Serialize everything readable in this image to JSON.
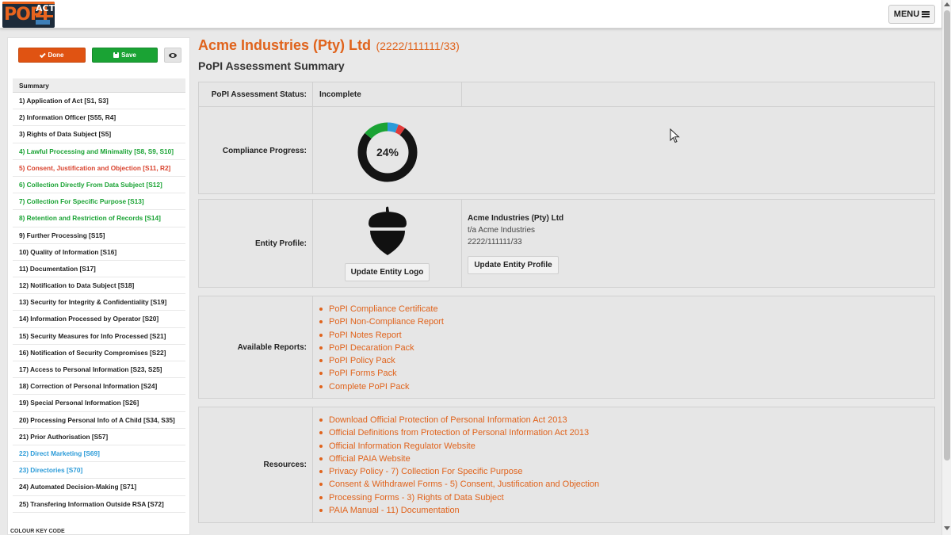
{
  "topbar": {
    "logo_text": "POPI",
    "logo_act": "ACT",
    "menu_label": "MENU"
  },
  "sidebar": {
    "done_label": "Done",
    "save_label": "Save",
    "colour_key_label": "COLOUR KEY CODE",
    "items": [
      {
        "label": "Summary",
        "status": "header"
      },
      {
        "label": "1) Application of Act [S1, S3]",
        "status": "black"
      },
      {
        "label": "2) Information Officer [S55, R4]",
        "status": "black"
      },
      {
        "label": "3) Rights of Data Subject [S5]",
        "status": "black"
      },
      {
        "label": "4) Lawful Processing and Minimality [S8, S9, S10]",
        "status": "green"
      },
      {
        "label": "5) Consent, Justification and Objection [S11, R2]",
        "status": "red"
      },
      {
        "label": "6) Collection Directly From Data Subject [S12]",
        "status": "green"
      },
      {
        "label": "7) Collection For Specific Purpose [S13]",
        "status": "green"
      },
      {
        "label": "8) Retention and Restriction of Records [S14]",
        "status": "green"
      },
      {
        "label": "9) Further Processing [S15]",
        "status": "black"
      },
      {
        "label": "10) Quality of Information [S16]",
        "status": "black"
      },
      {
        "label": "11) Documentation [S17]",
        "status": "black"
      },
      {
        "label": "12) Notification to Data Subject [S18]",
        "status": "black"
      },
      {
        "label": "13) Security for Integrity & Confidentiality [S19]",
        "status": "black"
      },
      {
        "label": "14) Information Processed by Operator [S20]",
        "status": "black"
      },
      {
        "label": "15) Security Measures for Info Processed [S21]",
        "status": "black"
      },
      {
        "label": "16) Notification of Security Compromises [S22]",
        "status": "black"
      },
      {
        "label": "17) Access to Personal Information [S23, S25]",
        "status": "black"
      },
      {
        "label": "18) Correction of Personal Information [S24]",
        "status": "black"
      },
      {
        "label": "19) Special Personal Information [S26]",
        "status": "black"
      },
      {
        "label": "20) Processing Personal Info of A Child [S34, S35]",
        "status": "black"
      },
      {
        "label": "21) Prior Authorisation [S57]",
        "status": "black"
      },
      {
        "label": "22) Direct Marketing [S69]",
        "status": "blue"
      },
      {
        "label": "23) Directories [S70]",
        "status": "blue"
      },
      {
        "label": "24) Automated Decision-Making [S71]",
        "status": "black"
      },
      {
        "label": "25) Transfering Information Outside RSA [S72]",
        "status": "black"
      }
    ]
  },
  "main": {
    "company_name": "Acme Industries (Pty) Ltd",
    "company_code": "(2222/111111/33)",
    "subtitle": "PoPI Assessment Summary",
    "status_label": "PoPI Assessment Status:",
    "status_value": "Incomplete",
    "progress_label": "Compliance Progress:",
    "progress_text": "24%",
    "progress": {
      "segments": [
        {
          "fraction": 0.06,
          "color": "#2b9bd8"
        },
        {
          "fraction": 0.04,
          "color": "#e03a3a"
        },
        {
          "fraction": 0.76,
          "color": "#141414"
        },
        {
          "fraction": 0.14,
          "color": "#1aa334"
        }
      ]
    },
    "entity_label": "Entity Profile:",
    "entity_name": "Acme Industries (Pty) Ltd",
    "entity_trading_as": "t/a Acme Industries",
    "entity_reg": "2222/111111/33",
    "update_logo_label": "Update Entity Logo",
    "update_profile_label": "Update Entity Profile",
    "reports_label": "Available Reports:",
    "reports": [
      "PoPI Compliance Certificate",
      "PoPI Non-Compliance Report",
      "PoPI Notes Report",
      "PoPI Decaration Pack",
      "PoPI Policy Pack",
      "PoPI Forms Pack",
      "Complete PoPI Pack"
    ],
    "resources_label": "Resources:",
    "resources": [
      "Download Official Protection of Personal Information Act 2013",
      "Official Definitions from Protection of Personal Information Act 2013",
      "Official Information Regulator Website",
      "Official PAIA Website",
      "Privacy Policy - 7) Collection For Specific Purpose",
      "Consent & Withdrawel Forms - 5) Consent, Justification and Objection",
      "Processing Forms - 3) Rights of Data Subject",
      "PAIA Manual - 11) Documentation"
    ]
  },
  "colors": {
    "accent": "#e0631c",
    "done": "#e05312",
    "save": "#1aa334",
    "complete_green": "#1aa334",
    "incomplete_red": "#d9432e",
    "na_blue": "#2b9bd8"
  },
  "icons": [
    "acorn-logo-icon",
    "eye-icon",
    "check-icon",
    "save-disk-icon",
    "menu-bars-icon",
    "mouse-cursor-icon"
  ]
}
